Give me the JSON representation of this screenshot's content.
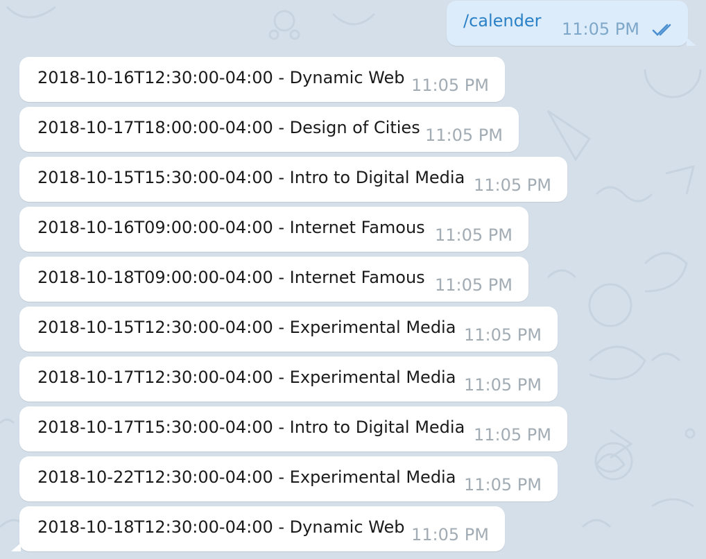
{
  "chat": {
    "outgoing": {
      "text": "/calender",
      "time": "11:05 PM",
      "status_icon": "double-check-icon"
    },
    "messages": [
      {
        "text": "2018-10-16T12:30:00-04:00 - Dynamic Web",
        "time": "11:05 PM"
      },
      {
        "text": "2018-10-17T18:00:00-04:00 - Design of Cities",
        "time": "11:05 PM"
      },
      {
        "text": "2018-10-15T15:30:00-04:00 - Intro to Digital Media",
        "time": "11:05 PM"
      },
      {
        "text": "2018-10-16T09:00:00-04:00 - Internet Famous",
        "time": "11:05 PM"
      },
      {
        "text": "2018-10-18T09:00:00-04:00 - Internet Famous",
        "time": "11:05 PM"
      },
      {
        "text": "2018-10-15T12:30:00-04:00 - Experimental Media",
        "time": "11:05 PM"
      },
      {
        "text": "2018-10-17T12:30:00-04:00 - Experimental Media",
        "time": "11:05 PM"
      },
      {
        "text": "2018-10-17T15:30:00-04:00 - Intro to Digital Media",
        "time": "11:05 PM"
      },
      {
        "text": "2018-10-22T12:30:00-04:00 - Experimental Media",
        "time": "11:05 PM"
      },
      {
        "text": "2018-10-18T12:30:00-04:00 - Dynamic Web",
        "time": "11:05 PM"
      }
    ]
  },
  "colors": {
    "background": "#d5dfe9",
    "outgoing_bubble": "#dcecfa",
    "incoming_bubble": "#ffffff",
    "link_text": "#2a81c7",
    "time_text": "#a2acb4"
  }
}
